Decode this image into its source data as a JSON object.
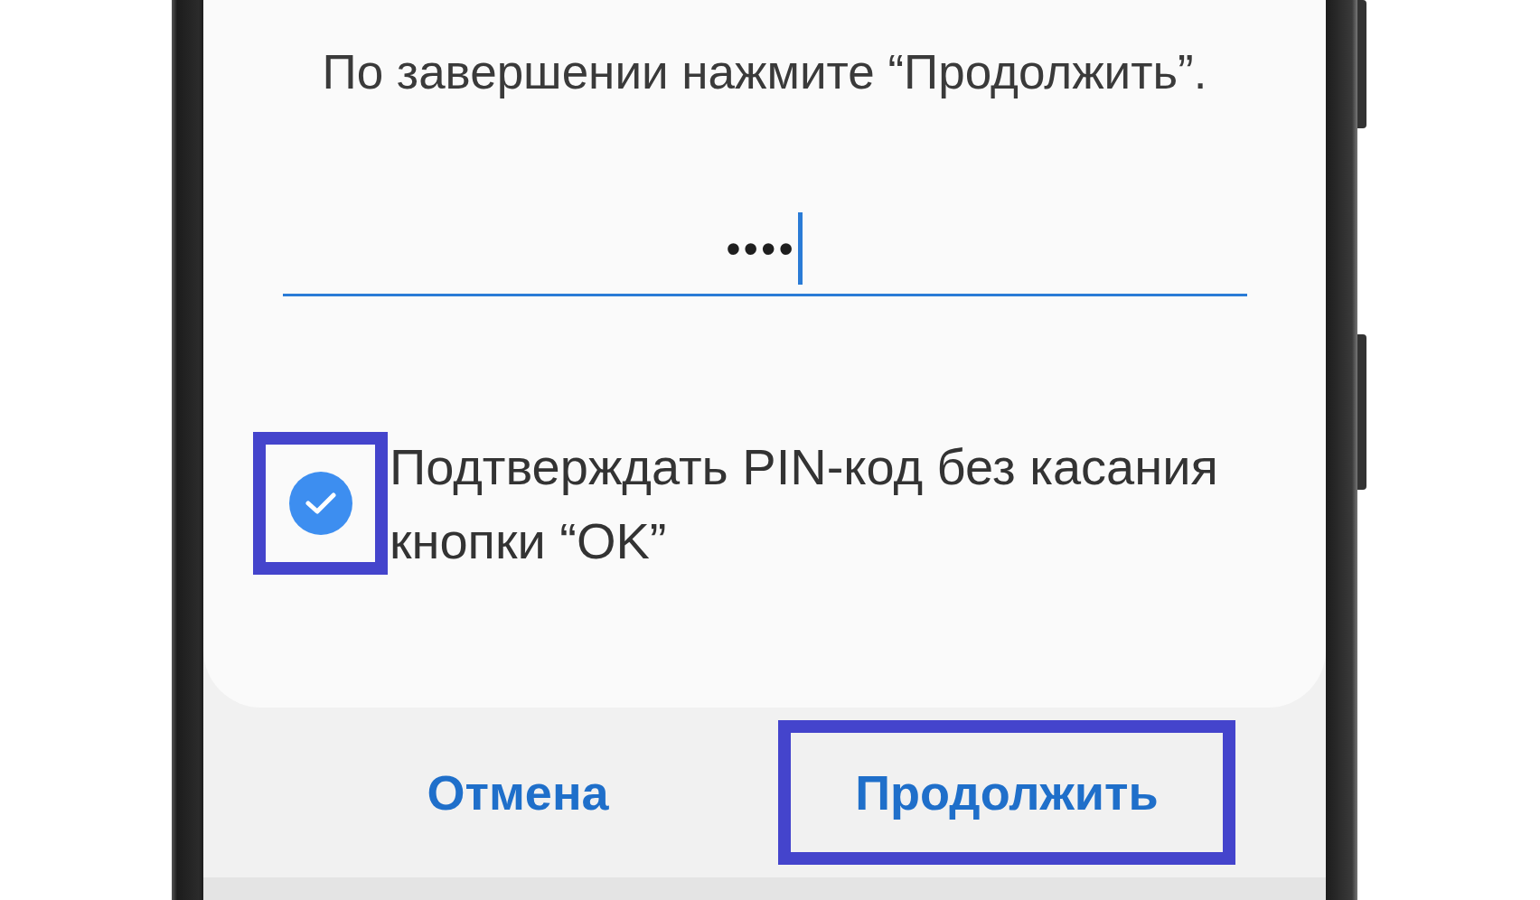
{
  "dialog": {
    "message": "По завершении нажмите “Продолжить”.",
    "pin_field": {
      "value": "••••",
      "focused": true
    },
    "checkbox": {
      "label": "Подтверждать PIN-код без касания кнопки “OK”",
      "checked": true,
      "highlighted": true
    }
  },
  "buttons": [
    {
      "label": "Отмена",
      "highlighted": false
    },
    {
      "label": "Продолжить",
      "highlighted": true
    }
  ]
}
